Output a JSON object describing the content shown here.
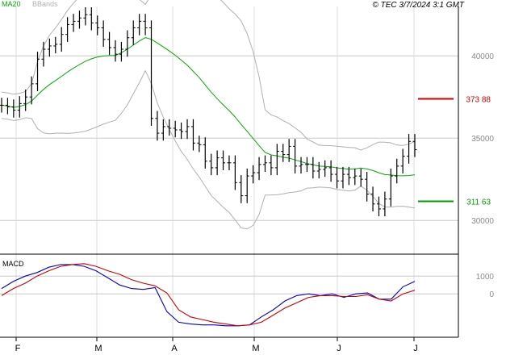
{
  "header": {
    "ma_label": "MA20",
    "bbands_label": "BBands",
    "copyright": "© TEC 3/7/2024 3:1 GMT",
    "ma_color": "#00aa00",
    "bbands_color": "#b0b0b0"
  },
  "macd_panel": {
    "label": "MACD"
  },
  "colors": {
    "macd_line": "#0000cc",
    "signal_line": "#cc0000",
    "grid": "#c8c8c8",
    "frame": "#000000",
    "resistance": "#cc0000",
    "support": "#009900"
  },
  "chart_data": [
    {
      "type": "ohlc",
      "x_ticks": [
        "F",
        "M",
        "A",
        "M",
        "J",
        "J"
      ],
      "y_ticks": [
        "30000",
        "35000",
        "40000"
      ],
      "ylim": [
        28000,
        43000
      ],
      "levels": [
        {
          "name": "resistance",
          "value": 37388,
          "label": "373 88"
        },
        {
          "name": "support",
          "value": 31163,
          "label": "311 63"
        }
      ],
      "price_series": [
        37000,
        36900,
        36700,
        37100,
        37500,
        38300,
        39800,
        40400,
        40600,
        40700,
        41300,
        41900,
        42100,
        42300,
        42500,
        42000,
        41700,
        41000,
        40500,
        40100,
        40400,
        41100,
        41700,
        42100,
        41700,
        36200,
        35300,
        35700,
        35600,
        35500,
        35400,
        35700,
        34700,
        34600,
        33600,
        33200,
        33800,
        33500,
        33500,
        32300,
        31500,
        32700,
        32900,
        33400,
        33500,
        33200,
        34200,
        34000,
        34500,
        33300,
        33400,
        33400,
        33000,
        33100,
        33200,
        32800,
        32400,
        32800,
        32600,
        32700,
        32500,
        31600,
        31000,
        30700,
        31300,
        32700,
        33300,
        33900,
        34800,
        34300
      ]
    },
    {
      "type": "line",
      "title": "MACD",
      "y_ticks": [
        "1000",
        "0"
      ],
      "ylim": [
        -2400,
        2100
      ],
      "series": [
        {
          "name": "",
          "values": [
            300,
            700,
            1000,
            1200,
            1500,
            1650,
            1650,
            1550,
            1300,
            900,
            500,
            300,
            250,
            350,
            -1000,
            -1600,
            -1700,
            -1750,
            -1750,
            -1800,
            -1800,
            -1750,
            -1300,
            -900,
            -400,
            -100,
            0,
            -100,
            0,
            -200,
            0,
            50,
            -300,
            -300,
            400,
            700
          ]
        },
        {
          "name": "",
          "values": [
            -100,
            300,
            600,
            1000,
            1300,
            1550,
            1650,
            1700,
            1550,
            1300,
            1100,
            800,
            600,
            450,
            50,
            -900,
            -1300,
            -1450,
            -1600,
            -1700,
            -1800,
            -1750,
            -1600,
            -1200,
            -800,
            -500,
            -200,
            -100,
            -100,
            -150,
            -150,
            -50,
            -300,
            -400,
            0,
            200
          ]
        }
      ]
    }
  ]
}
